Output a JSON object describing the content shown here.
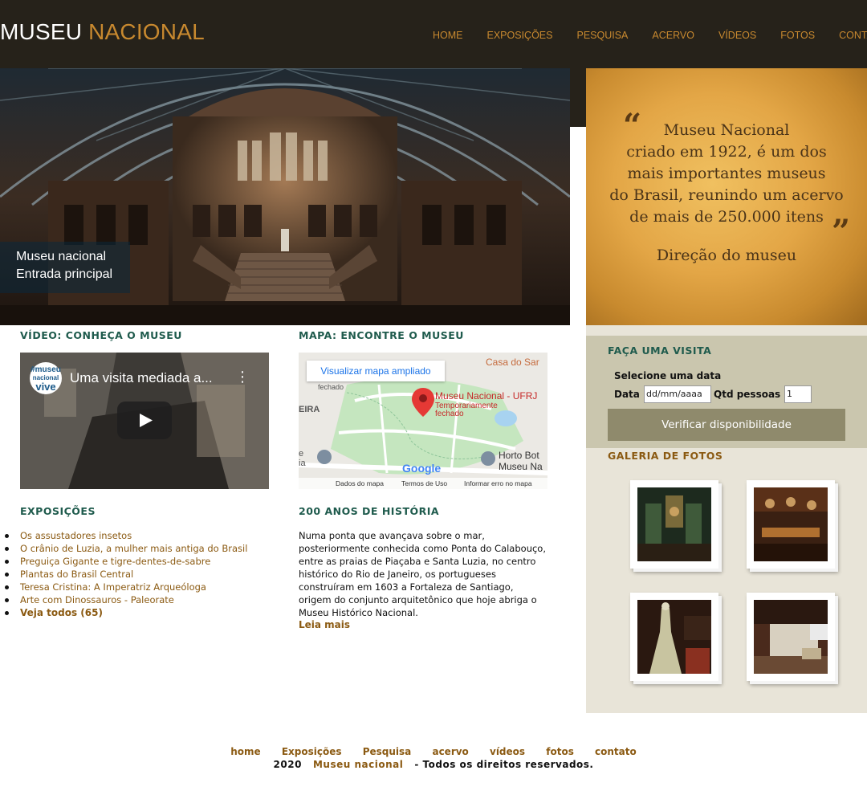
{
  "brand": {
    "word1": "MUSEU",
    "word2": "NACIONAL"
  },
  "nav": [
    "HOME",
    "EXPOSIÇÕES",
    "PESQUISA",
    "ACERVO",
    "VÍDEOS",
    "FOTOS",
    "CONTATO"
  ],
  "hero": {
    "caption_line1": "Museu nacional",
    "caption_line2": "Entrada principal"
  },
  "quote": {
    "lines": [
      "Museu Nacional",
      "criado em 1922, é um dos",
      "mais importantes museus",
      "do Brasil, reunindo um acervo",
      "de mais de 250.000 itens"
    ],
    "signature": "Direção do museu"
  },
  "video_section": {
    "title": "VÍDEO: CONHEÇA O MUSEU",
    "video_title": "Uma visita mediada a...",
    "channel_logo": [
      "#museu",
      "nacional",
      "vive"
    ]
  },
  "map_section": {
    "title": "MAPA: ENCONTRE O MUSEU",
    "button": "Visualizar mapa ampliado",
    "place": "Museu Nacional - UFRJ",
    "status_line1": "Temporariamente",
    "status_line2": "fechado",
    "label_casa": "Casa do Sar",
    "label_fechado": "fechado",
    "label_eira": "EIRA",
    "label_horto1": "Horto Bot",
    "label_horto2": "Museu Na",
    "label_ia": "ia",
    "label_e": "e",
    "google": "Google",
    "footer": [
      "Dados do mapa",
      "Termos de Uso",
      "Informar erro no mapa"
    ]
  },
  "exposicoes": {
    "title": "EXPOSIÇÕES",
    "items": [
      "Os assustadores insetos",
      "O crânio de Luzia, a mulher mais antiga do Brasil",
      "Preguiça Gigante e tigre-dentes-de-sabre",
      "Plantas do Brasil Central",
      "Teresa Cristina: A Imperatriz Arqueóloga",
      "Arte com Dinossauros - Paleorate"
    ],
    "see_all": "Veja todos (65)"
  },
  "historia": {
    "title": "200 ANOS DE HISTÓRIA",
    "lines": [
      "Numa ponta que avançava sobre o mar,",
      "posteriormente conhecida como Ponta do Calabouço,",
      "entre as praias de Piaçaba e Santa Luzia, no centro",
      "histórico do Rio de Janeiro, os portugueses",
      "construíram em 1603 a Fortaleza de Santiago,",
      "origem do conjunto arquitetônico que hoje abriga o",
      "Museu Histórico Nacional."
    ],
    "more": "Leia mais"
  },
  "visit": {
    "title": "FAÇA UMA VISITA",
    "select_label": "Selecione uma data",
    "date_label": "Data",
    "date_placeholder": "dd/mm/aaaa",
    "qty_label": "Qtd pessoas",
    "qty_value": "1",
    "button": "Verificar disponibilidade"
  },
  "gallery": {
    "title": "GALERIA DE FOTOS"
  },
  "footer": {
    "links": [
      "home",
      "Exposições",
      "Pesquisa",
      "acervo",
      "vídeos",
      "fotos",
      "contato"
    ],
    "year": "2020",
    "brand": "Museu nacional",
    "rights": "- Todos os direitos reservados."
  },
  "colors": {
    "header_bg": "#26221a",
    "accent_gold": "#c8892f",
    "link_brown": "#8b5a12",
    "heading_green": "#1f5b4d",
    "sidebar_bg": "#e8e4d8",
    "visit_bg": "#cac6ae",
    "button_bg": "#8f8a6c"
  }
}
